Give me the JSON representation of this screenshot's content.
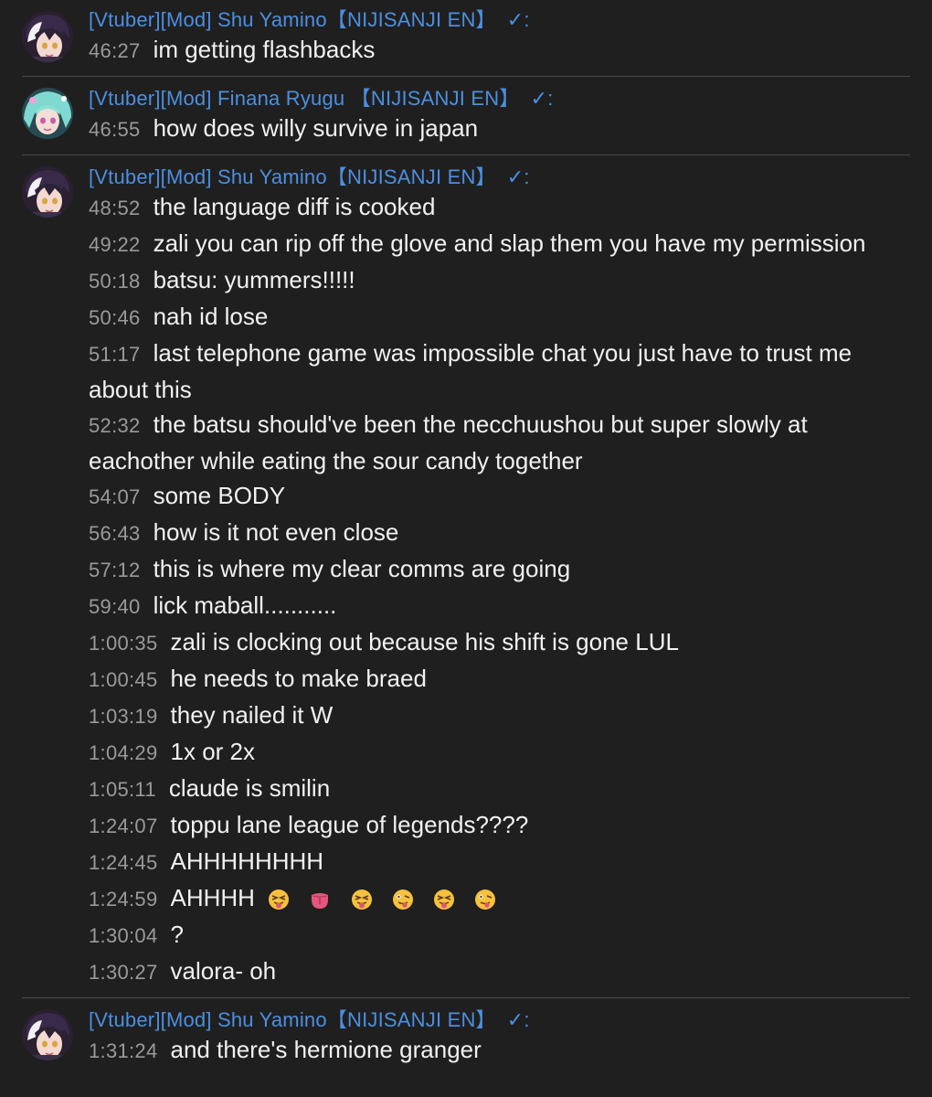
{
  "colors": {
    "background": "#1f1f1f",
    "author": "#4c8fe0",
    "timestamp": "#9a9a9a",
    "text": "#f1f1f1",
    "divider": "#4a4a4a"
  },
  "blocks": [
    {
      "author": "[Vtuber][Mod] Shu Yamino【NIJISANJI EN】",
      "check": "✓:",
      "avatar": "shu-avatar",
      "messages": [
        {
          "time": "46:27",
          "text": "im getting flashbacks"
        }
      ]
    },
    {
      "author": "[Vtuber][Mod] Finana Ryugu 【NIJISANJI EN】",
      "check": "✓:",
      "avatar": "finana-avatar",
      "messages": [
        {
          "time": "46:55",
          "text": "how does willy survive in japan"
        }
      ]
    },
    {
      "author": "[Vtuber][Mod] Shu Yamino【NIJISANJI EN】",
      "check": "✓:",
      "avatar": "shu-avatar",
      "messages": [
        {
          "time": "48:52",
          "text": "the language diff is cooked"
        },
        {
          "time": "49:22",
          "text": "zali you can rip off the glove and slap them you have my permission"
        },
        {
          "time": "50:18",
          "text": "batsu: yummers!!!!!"
        },
        {
          "time": "50:46",
          "text": "nah id lose"
        },
        {
          "time": "51:17",
          "text": "last telephone game was impossible chat you just have to trust me about this"
        },
        {
          "time": "52:32",
          "text": "the batsu should've been the necchuushou but super slowly at eachother while eating the sour candy together"
        },
        {
          "time": "54:07",
          "text": "some BODY"
        },
        {
          "time": "56:43",
          "text": "how is it not even close"
        },
        {
          "time": "57:12",
          "text": "this is where my clear comms are going"
        },
        {
          "time": "59:40",
          "text": "lick maball..........."
        },
        {
          "time": "1:00:35",
          "text": "zali is clocking out because his shift is gone LUL"
        },
        {
          "time": "1:00:45",
          "text": "he needs to make braed"
        },
        {
          "time": "1:03:19",
          "text": "they nailed it W"
        },
        {
          "time": "1:04:29",
          "text": "1x or 2x"
        },
        {
          "time": "1:05:11",
          "text": "claude is smilin"
        },
        {
          "time": "1:24:07",
          "text": "toppu lane league of legends????"
        },
        {
          "time": "1:24:45",
          "text": "AHHHHHHHH"
        },
        {
          "time": "1:24:59",
          "text": "AHHHH",
          "emojis": [
            "squint-tongue-emoji",
            "tongue-emoji",
            "squint-tongue-emoji",
            "zany-face-emoji",
            "squint-tongue-emoji",
            "zany-face-emoji"
          ]
        },
        {
          "time": "1:30:04",
          "text": "?"
        },
        {
          "time": "1:30:27",
          "text": "valora- oh"
        }
      ]
    },
    {
      "author": "[Vtuber][Mod] Shu Yamino【NIJISANJI EN】",
      "check": "✓:",
      "avatar": "shu-avatar",
      "messages": [
        {
          "time": "1:31:24",
          "text": "and there's hermione granger"
        }
      ]
    }
  ]
}
